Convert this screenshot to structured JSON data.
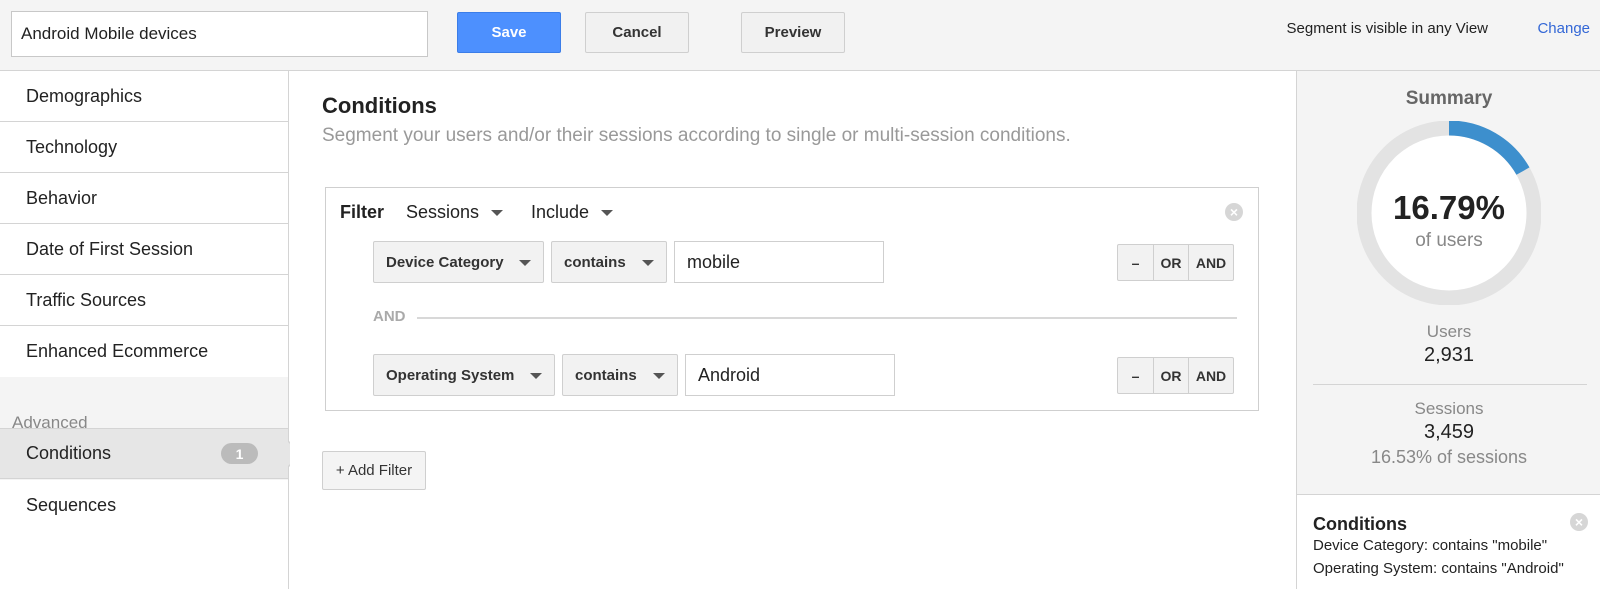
{
  "header": {
    "segment_name": "Android Mobile devices",
    "save_label": "Save",
    "cancel_label": "Cancel",
    "preview_label": "Preview",
    "visibility_text": "Segment is visible in any View",
    "change_label": "Change"
  },
  "sidebar": {
    "items": [
      {
        "label": "Demographics"
      },
      {
        "label": "Technology"
      },
      {
        "label": "Behavior"
      },
      {
        "label": "Date of First Session"
      },
      {
        "label": "Traffic Sources"
      },
      {
        "label": "Enhanced Ecommerce"
      }
    ],
    "advanced_heading": "Advanced",
    "advanced_items": [
      {
        "label": "Conditions",
        "badge": "1",
        "active": true
      },
      {
        "label": "Sequences"
      }
    ]
  },
  "main": {
    "title": "Conditions",
    "subtitle": "Segment your users and/or their sessions according to single or multi-session conditions.",
    "filter": {
      "label": "Filter",
      "scope": "Sessions",
      "mode": "Include",
      "connector": "AND",
      "conditions": [
        {
          "dimension": "Device Category",
          "operator": "contains",
          "value": "mobile"
        },
        {
          "dimension": "Operating System",
          "operator": "contains",
          "value": "Android"
        }
      ],
      "row_buttons": {
        "remove": "–",
        "or": "OR",
        "and": "AND"
      }
    },
    "add_filter_label": "+ Add Filter"
  },
  "summary": {
    "title": "Summary",
    "percent": "16.79%",
    "percent_fraction": 0.1679,
    "percent_sub": "of users",
    "users_label": "Users",
    "users_value": "2,931",
    "sessions_label": "Sessions",
    "sessions_value": "3,459",
    "sessions_pct": "16.53% of sessions",
    "conditions_title": "Conditions",
    "conditions_lines": [
      "Device Category: contains \"mobile\"",
      "Operating System: contains \"Android\""
    ]
  },
  "colors": {
    "accent": "#4d90fe",
    "donut_fill": "#3d8fcd",
    "donut_track": "#e3e3e3",
    "link": "#3367d6"
  },
  "icons": {
    "remove_filter": "close-circle-icon",
    "remove_condition": "close-circle-icon",
    "dropdown": "caret-down-icon"
  }
}
